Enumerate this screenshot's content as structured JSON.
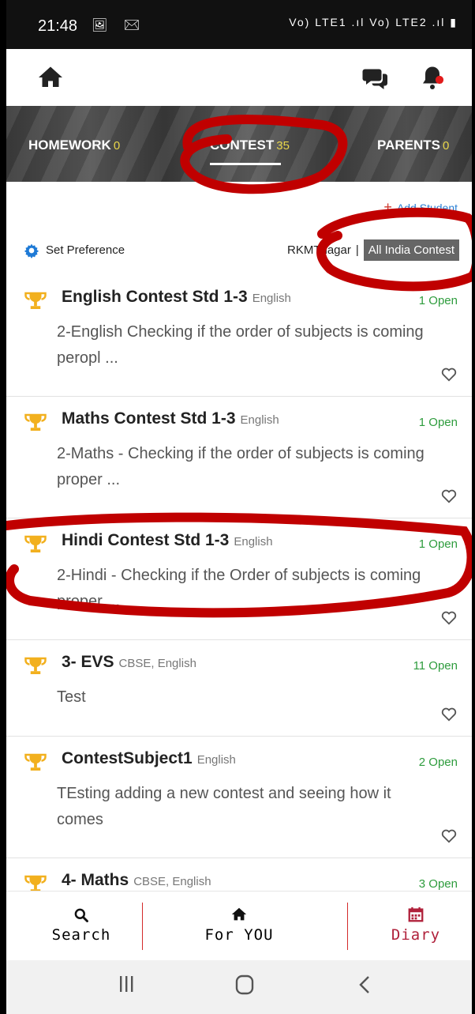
{
  "status_bar": {
    "time": "21:48",
    "left_icons": "🖼 ✉",
    "right_icons": "Vo) LTE1 .ıl  Vo) LTE2 .ıl  ▮"
  },
  "app_bar": {
    "home_icon": "home-icon",
    "chat_icon": "chat-icon",
    "bell_icon": "bell-icon"
  },
  "tabs": [
    {
      "label": "HOMEWORK",
      "count": "0"
    },
    {
      "label": "CONTEST",
      "count": "35",
      "active": true
    },
    {
      "label": "PARENTS",
      "count": "0"
    }
  ],
  "add_student": {
    "label": "Add Student"
  },
  "preference": {
    "label": "Set Preference"
  },
  "filters": {
    "school": "RKMTnagar",
    "all_india": "All India Contest"
  },
  "contests": [
    {
      "title": "English Contest Std 1-3",
      "sub": "English",
      "open": "1 Open",
      "desc": "2-English Checking if the order of subjects is coming peropl ..."
    },
    {
      "title": "Maths Contest Std 1-3",
      "sub": "English",
      "open": "1 Open",
      "desc": "2-Maths - Checking if the order of subjects is coming proper ..."
    },
    {
      "title": "Hindi Contest Std 1-3",
      "sub": "English",
      "open": "1 Open",
      "desc": "2-Hindi - Checking if the Order of subjects is coming proper ..."
    },
    {
      "title": "3- EVS",
      "sub": "CBSE, English",
      "open": "11 Open",
      "desc": "Test"
    },
    {
      "title": "ContestSubject1",
      "sub": "English",
      "open": "2 Open",
      "desc": "TEsting adding a new contest and seeing how it comes"
    },
    {
      "title": "4- Maths",
      "sub": "CBSE, English",
      "open": "3 Open",
      "desc": ""
    }
  ],
  "bottom_nav": {
    "search": "Search",
    "for_you": "For YOU",
    "diary": "Diary"
  },
  "colors": {
    "accent_red": "#c00000",
    "open_green": "#2e9c3d",
    "trophy_gold": "#f2b01e",
    "gear_blue": "#1e7ad6"
  }
}
